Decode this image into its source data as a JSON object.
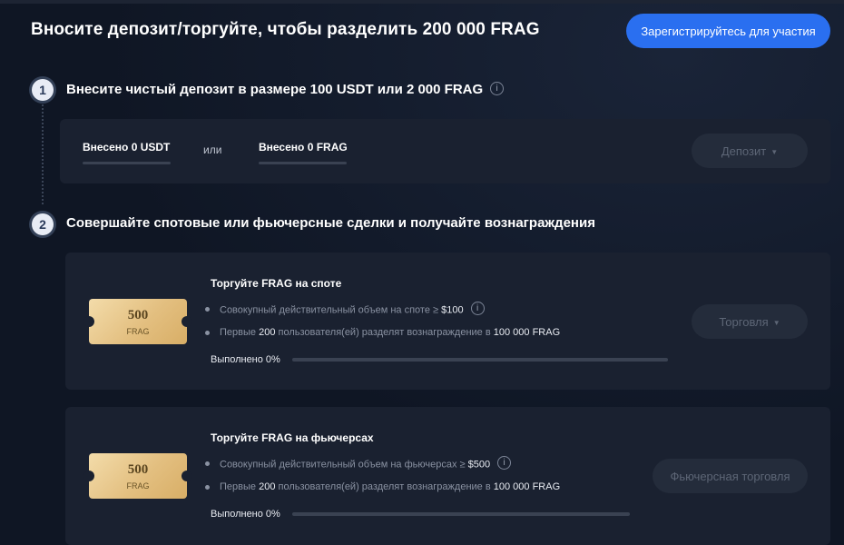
{
  "header": {
    "title": "Вносите депозит/торгуйте, чтобы разделить 200 000 FRAG",
    "register_label": "Зарегистрируйтесь для участия"
  },
  "steps": [
    {
      "number": "1",
      "title": "Внесите чистый депозит в размере 100 USDT или 2 000 FRAG",
      "info_icon": "i"
    },
    {
      "number": "2",
      "title": "Совершайте спотовые или фьючерсные сделки и получайте вознаграждения"
    }
  ],
  "deposit": {
    "usdt_label": "Внесено 0 USDT",
    "or_label": "или",
    "frag_label": "Внесено 0 FRAG",
    "button_label": "Депозит",
    "button_caret": "▼"
  },
  "cards": [
    {
      "ticket_amount": "500",
      "ticket_unit": "FRAG",
      "title": "Торгуйте FRAG на споте",
      "line1_prefix": "Совокупный действительный объем на споте ≥ ",
      "line1_value": "$100",
      "line1_info": "i",
      "line2_prefix": "Первые ",
      "line2_count": "200",
      "line2_mid": " пользователя(ей) разделят вознаграждение в ",
      "line2_reward": "100 000 FRAG",
      "progress_label": "Выполнено 0%",
      "progress_fraction": 0,
      "button_label": "Торговля",
      "button_caret": "▼"
    },
    {
      "ticket_amount": "500",
      "ticket_unit": "FRAG",
      "title": "Торгуйте FRAG на фьючерсах",
      "line1_prefix": "Совокупный действительный объем на фьючерсах ≥ ",
      "line1_value": "$500",
      "line1_info": "i",
      "line2_prefix": "Первые ",
      "line2_count": "200",
      "line2_mid": " пользователя(ей) разделят вознаграждение в ",
      "line2_reward": "100 000 FRAG",
      "progress_label": "Выполнено 0%",
      "progress_fraction": 0,
      "button_label": "Фьючерсная торговля"
    }
  ],
  "colors": {
    "accent": "#2a6ff0",
    "background": "#0f1624",
    "panel": "#1a2130"
  }
}
